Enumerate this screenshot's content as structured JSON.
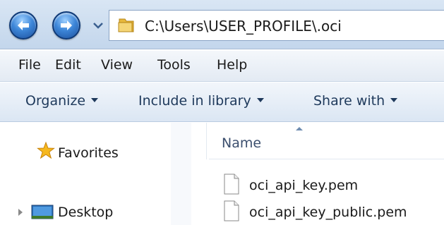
{
  "address_bar": {
    "path": "C:\\Users\\USER_PROFILE\\.oci",
    "back_icon": "back-arrow-icon",
    "forward_icon": "forward-arrow-icon",
    "folder_icon": "folder-icon"
  },
  "menu": {
    "items": [
      {
        "label": "File"
      },
      {
        "label": "Edit"
      },
      {
        "label": "View"
      },
      {
        "label": "Tools"
      },
      {
        "label": "Help"
      }
    ]
  },
  "command_bar": {
    "items": [
      {
        "label": "Organize"
      },
      {
        "label": "Include in library"
      },
      {
        "label": "Share with"
      }
    ]
  },
  "navigation": {
    "favorites": "Favorites",
    "desktop": "Desktop"
  },
  "file_list": {
    "column_name": "Name",
    "files": [
      {
        "name": "oci_api_key.pem"
      },
      {
        "name": "oci_api_key_public.pem"
      }
    ]
  },
  "colors": {
    "accent": "#3d86d8",
    "command_text": "#1e395b",
    "folder": "#e8b93c"
  }
}
